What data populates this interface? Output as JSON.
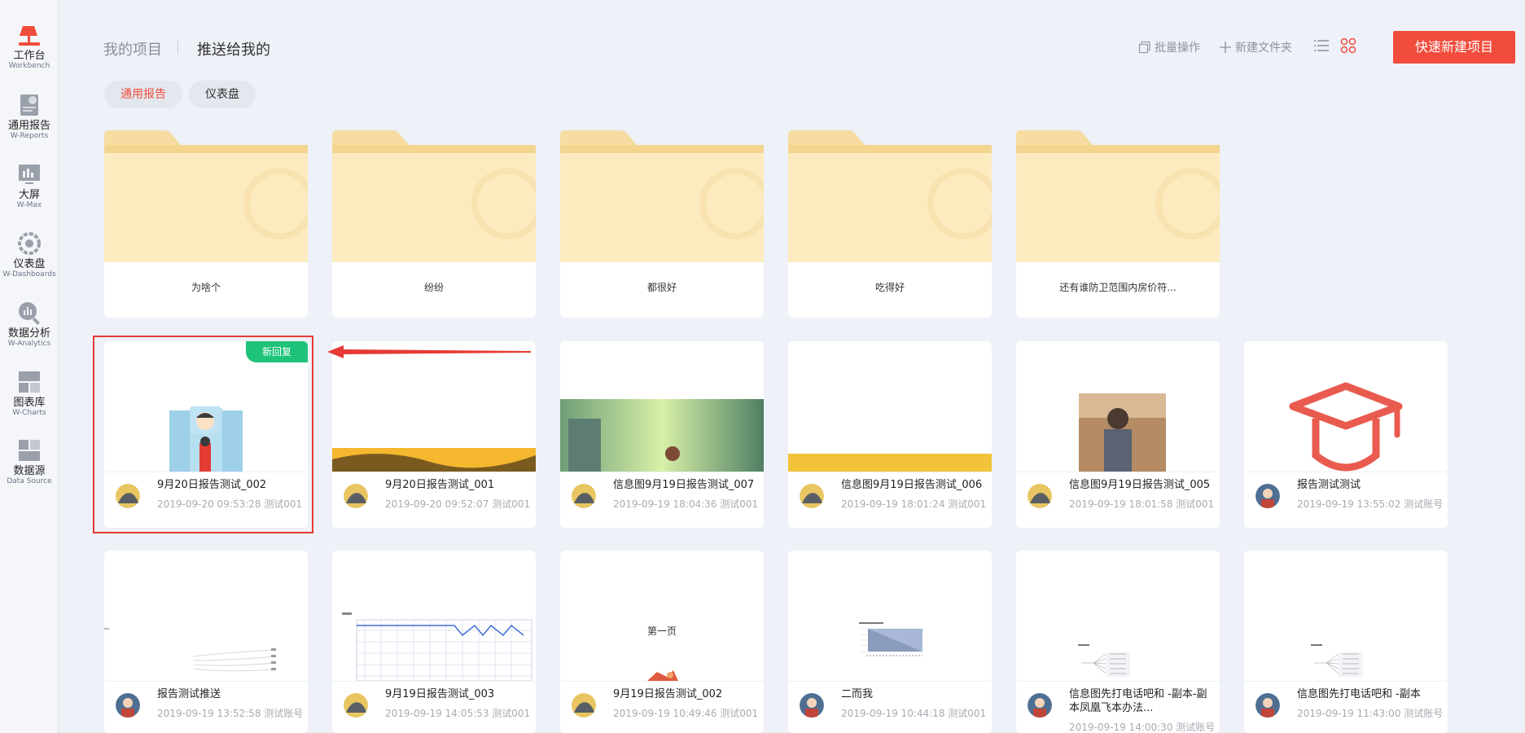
{
  "sidebar": {
    "items": [
      {
        "label": "工作台",
        "sub": "Workbench",
        "icon": "workbench-icon"
      },
      {
        "label": "通用报告",
        "sub": "W-Reports",
        "icon": "report-icon"
      },
      {
        "label": "大屏",
        "sub": "W-Max",
        "icon": "big-screen-icon"
      },
      {
        "label": "仪表盘",
        "sub": "W-Dashboards",
        "icon": "dashboard-icon"
      },
      {
        "label": "数据分析",
        "sub": "W-Analytics",
        "icon": "analytics-icon"
      },
      {
        "label": "图表库",
        "sub": "W-Charts",
        "icon": "chart-library-icon"
      },
      {
        "label": "数据源",
        "sub": "Data Source",
        "icon": "data-source-icon"
      }
    ]
  },
  "header": {
    "tab_mine": "我的项目",
    "tab_pushed": "推送给我的",
    "batch_label": "批量操作",
    "new_folder_label": "新建文件夹",
    "new_project_label": "快速新建项目"
  },
  "filters": {
    "reports": "通用报告",
    "dashboards": "仪表盘"
  },
  "folders": [
    "为啥个",
    "纷纷",
    "都很好",
    "吃得好",
    "还有谁防卫范围内房价符..."
  ],
  "row1": [
    {
      "title": "9月20日报告测试_002",
      "meta": "2019-09-20 09:53:28 测试001",
      "badge": "新回复"
    },
    {
      "title": "9月20日报告测试_001",
      "meta": "2019-09-20 09:52:07 测试001"
    },
    {
      "title": "信息图9月19日报告测试_007",
      "meta": "2019-09-19 18:04:36 测试001"
    },
    {
      "title": "信息图9月19日报告测试_006",
      "meta": "2019-09-19 18:01:24 测试001"
    },
    {
      "title": "信息图9月19日报告测试_005",
      "meta": "2019-09-19 18:01:58 测试001"
    },
    {
      "title": "报告测试测试",
      "meta": "2019-09-19 13:55:02 测试账号"
    }
  ],
  "row2": [
    {
      "title": "报告测试推送",
      "meta": "2019-09-19 13:52:58 测试账号"
    },
    {
      "title": "9月19日报告测试_003",
      "meta": "2019-09-19 14:05:53 测试001"
    },
    {
      "title": "9月19日报告测试_002",
      "meta": "2019-09-19 10:49:46 测试001",
      "thumb_text": "第一页"
    },
    {
      "title": "二而我",
      "meta": "2019-09-19 10:44:18 测试001"
    },
    {
      "title": "信息图先打电话吧和 -副本-副本凤凰飞本办法...",
      "meta": "2019-09-19 14:00:30 测试账号"
    },
    {
      "title": "信息图先打电话吧和 -副本",
      "meta": "2019-09-19 11:43:00 测试账号"
    }
  ],
  "colors": {
    "accent": "#f14c3c",
    "badge": "#1ec37a",
    "folder": "#fdebc0",
    "folder_tab": "#f6dca1"
  }
}
